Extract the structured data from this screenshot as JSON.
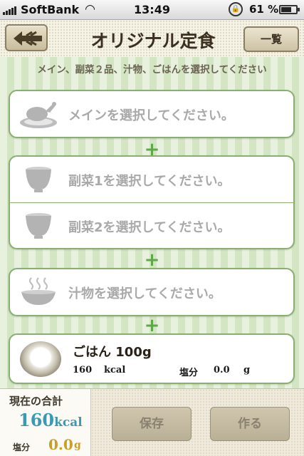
{
  "status_bar": {
    "carrier": "SoftBank",
    "time": "13:49",
    "battery_percent": "61 %"
  },
  "header": {
    "title": "オリジナル定食",
    "list_button": "一覧"
  },
  "instruction": "メイン、副菜２品、汁物、ごはんを選択してください",
  "plus_sign": "+",
  "slots": {
    "main": {
      "label": "メインを選択してください。",
      "icon": "roast-chicken-icon"
    },
    "side1": {
      "label": "副菜1を選択してください。",
      "icon": "bowl-icon"
    },
    "side2": {
      "label": "副菜2を選択してください。",
      "icon": "bowl-icon"
    },
    "soup": {
      "label": "汁物を選択してください。",
      "icon": "soup-bowl-icon"
    }
  },
  "rice": {
    "name": "ごはん 100g",
    "kcal_value": "160",
    "kcal_unit": "kcal",
    "salt_label": "塩分",
    "salt_value": "0.0",
    "salt_unit": "g"
  },
  "totals": {
    "label": "現在の合計",
    "kcal_value": "160",
    "kcal_unit": "kcal",
    "salt_label": "塩分",
    "salt_value": "0.0",
    "salt_unit": "g"
  },
  "actions": {
    "save": "保存",
    "make": "作る"
  },
  "colors": {
    "accent_green": "#5fa84a",
    "kcal_blue": "#3c9ab0",
    "salt_gold": "#c6a028"
  }
}
